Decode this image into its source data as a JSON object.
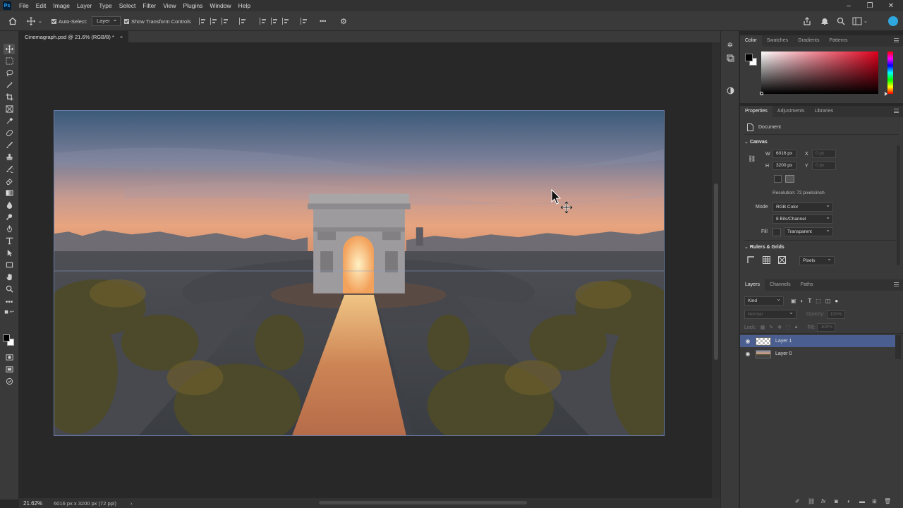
{
  "menubar": {
    "app_logo": "Ps",
    "items": [
      "File",
      "Edit",
      "Image",
      "Layer",
      "Type",
      "Select",
      "Filter",
      "View",
      "Plugins",
      "Window",
      "Help"
    ]
  },
  "options": {
    "auto_select": "Auto-Select:",
    "auto_select_target": "Layer",
    "show_transform": "Show Transform Controls",
    "more": "•••"
  },
  "document": {
    "tab_title": "Cinemagraph.psd @ 21.6% (RGB/8) *",
    "close": "×"
  },
  "status": {
    "zoom": "21.62%",
    "info": "6016 px x 3200 px (72 ppi)",
    "arrow": "›"
  },
  "color_panel": {
    "tabs": [
      "Color",
      "Swatches",
      "Gradients",
      "Patterns"
    ]
  },
  "properties_panel": {
    "tabs": [
      "Properties",
      "Adjustments",
      "Libraries"
    ],
    "doc_label": "Document",
    "canvas_section": "Canvas",
    "w_label": "W",
    "w_value": "6016 px",
    "h_label": "H",
    "h_value": "3200 px",
    "x_label": "X",
    "x_value": "0 px",
    "y_label": "Y",
    "y_value": "0 px",
    "resolution": "Resolution: 72 pixels/inch",
    "mode_label": "Mode",
    "mode_value": "RGB Color",
    "bits_value": "8 Bits/Channel",
    "fill_label": "Fill",
    "fill_value": "Transparent",
    "rulers_section": "Rulers & Grids",
    "units_value": "Pixels"
  },
  "layers_panel": {
    "tabs": [
      "Layers",
      "Channels",
      "Paths"
    ],
    "filter_kind": "Kind",
    "blend_mode": "Normal",
    "opacity_label": "Opacity:",
    "opacity_value": "100%",
    "lock_label": "Lock:",
    "fill_label": "Fill:",
    "fill_value": "100%",
    "layers": [
      {
        "name": "Layer 1",
        "selected": true
      },
      {
        "name": "Layer 0",
        "selected": false
      }
    ]
  },
  "colors": {
    "accent_selected_layer": "#4a5e90",
    "app_bg": "#282828",
    "panel_bg": "#3a3a3a"
  }
}
